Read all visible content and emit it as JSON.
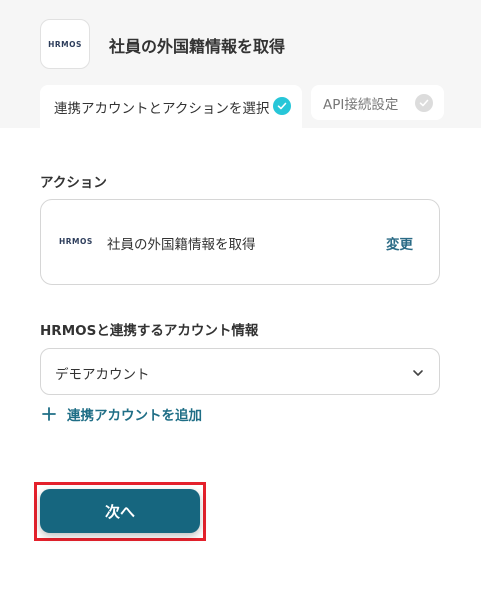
{
  "header": {
    "logo_text": "HRMOS",
    "app_title": "社員の外国籍情報を取得"
  },
  "tabs": [
    {
      "label": "連携アカウントとアクションを選択",
      "state": "active"
    },
    {
      "label": "API接続設定",
      "state": "inactive"
    }
  ],
  "action_section": {
    "label": "アクション",
    "card": {
      "logo_text": "HRMOS",
      "action_name": "社員の外国籍情報を取得",
      "change_label": "変更"
    }
  },
  "account_section": {
    "label": "HRMOSと連携するアカウント情報",
    "selected_value": "デモアカウント",
    "add_account_label": "連携アカウントを追加"
  },
  "footer": {
    "next_label": "次へ"
  },
  "colors": {
    "accent": "#16667f",
    "link": "#2b6b86",
    "check_active": "#27c6d8",
    "highlight": "#e4212c"
  }
}
